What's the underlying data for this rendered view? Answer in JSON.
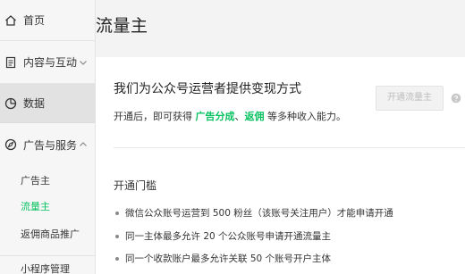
{
  "sidebar": {
    "home": {
      "label": "首页",
      "icon": "home-icon"
    },
    "content": {
      "label": "内容与互动",
      "icon": "document-icon"
    },
    "data": {
      "label": "数据",
      "icon": "pie-chart-icon"
    },
    "ads": {
      "label": "广告与服务",
      "icon": "compass-icon",
      "sub_items": [
        {
          "label": "广告主"
        },
        {
          "label": "流量主"
        },
        {
          "label": "返佣商品推广"
        },
        {
          "label": "小程序管理"
        }
      ]
    }
  },
  "page": {
    "title": "流量主"
  },
  "card": {
    "title": "我们为公众号运营者提供变现方式",
    "desc_prefix": "开通后，即可获得 ",
    "desc_hl1": "广告分成",
    "desc_sep": "、",
    "desc_hl2": "返佣",
    "desc_suffix": " 等多种收入能力。",
    "open_button": "开通流量主",
    "threshold_title": "开通门槛",
    "requirements": [
      "微信公众账号运营到 500 粉丝（该账号关注用户）才能申请开通",
      "同一主体最多允许 20 个公众账号申请开通流量主",
      "同一个收款账户最多允许关联 50 个账号开户主体"
    ]
  },
  "colors": {
    "accent": "#07c160",
    "sidebar_bg": "#f6f6f6",
    "active_bg": "#e2e2e2"
  }
}
